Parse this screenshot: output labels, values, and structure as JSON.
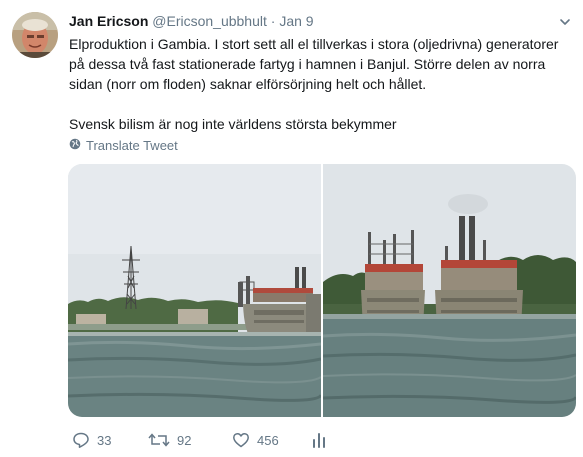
{
  "tweet": {
    "author_name": "Jan Ericson",
    "handle": "@Ericson_ubbhult",
    "separator": "·",
    "date": "Jan 9",
    "paragraph_1": "Elproduktion i Gambia. I stort sett all el tillverkas i stora (oljedrivna) generatorer på dessa två fast stationerade fartyg i hamnen i Banjul. Större delen av norra sidan (norr om floden) saknar elförsörjning helt och hållet.",
    "paragraph_2": "Svensk bilism är nog inte världens största bekymmer",
    "translate_label": "Translate Tweet"
  },
  "actions": {
    "replies": "33",
    "retweets": "92",
    "likes": "456"
  },
  "icons": {
    "avatar": "avatar",
    "caret": "chevron-down-icon",
    "translate": "globe-icon",
    "reply": "reply-icon",
    "retweet": "retweet-icon",
    "like": "heart-icon",
    "analytics": "analytics-icon"
  },
  "colors": {
    "text": "#14171a",
    "secondary": "#657786",
    "sky": "#dfe4e8",
    "water": "#5f7a7a"
  }
}
